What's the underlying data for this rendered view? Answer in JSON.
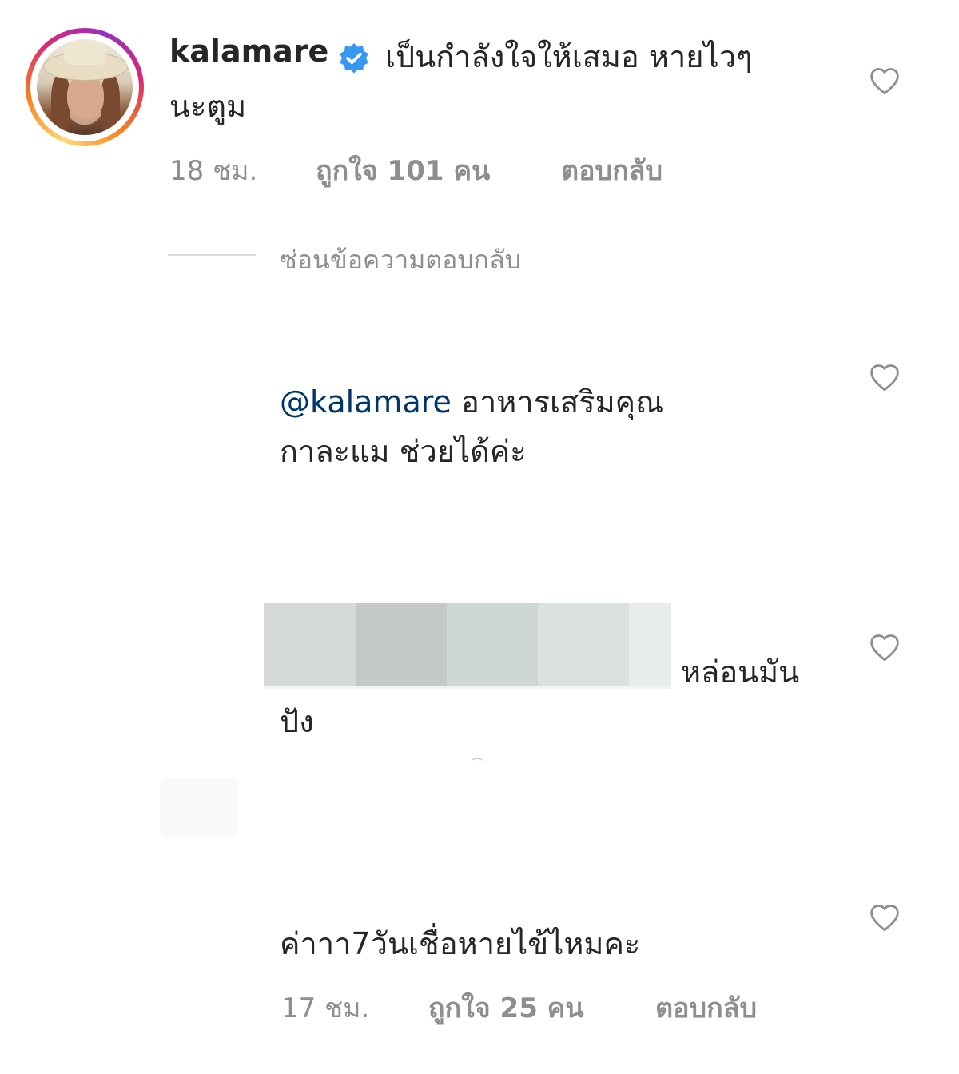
{
  "comment1": {
    "username": "kalamare",
    "verified_icon": "verified-badge-icon",
    "text_line1": "เป็นกำลังใจให้เสมอ หายไวๆ",
    "text_line2": "นะตูม",
    "time": "18 ชม.",
    "likes": "ถูกใจ 101 คน",
    "reply": "ตอบกลับ"
  },
  "hide_replies": "ซ่อนข้อความตอบกลับ",
  "reply1": {
    "mention": "@kalamare",
    "text_line1_rest": "อาหารเสริมคุณ",
    "text_line2": "กาละแม ช่วยได้ค่ะ"
  },
  "reply2": {
    "text_line1_end": "หล่อนมัน",
    "text_line2": "ปัง",
    "censor_colors": [
      "#d6d9d9",
      "#c4c8c8",
      "#cfd6d6",
      "#dbe1e1",
      "#e8ecec"
    ]
  },
  "reply3": {
    "text": "ค่าาา7วันเชื่อหายไข้ไหมคะ",
    "time": "17 ชม.",
    "likes": "ถูกใจ 25 คน",
    "reply": "ตอบกลับ"
  },
  "icons": {
    "heart": "heart-icon",
    "verified": "verified-badge-icon"
  },
  "colors": {
    "verified_blue": "#3897f0",
    "mention": "#00376b",
    "meta_gray": "#8e8e8e"
  }
}
